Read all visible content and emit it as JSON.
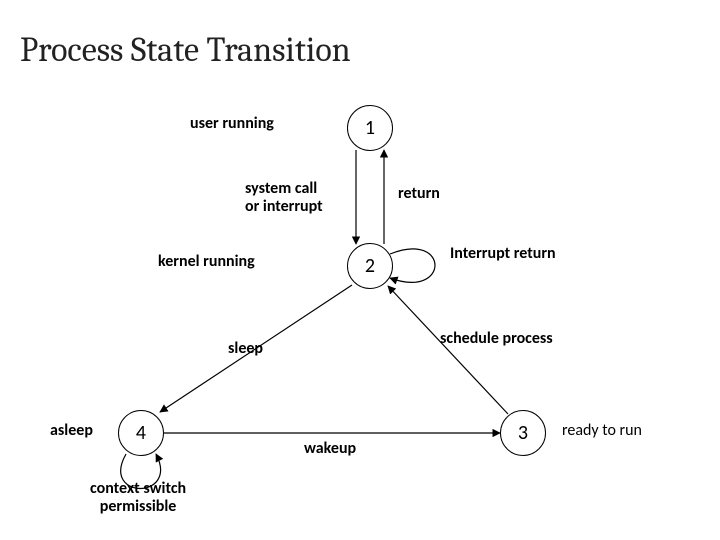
{
  "title": "Process State Transition",
  "nodes": {
    "n1": "1",
    "n2": "2",
    "n3": "3",
    "n4": "4"
  },
  "node_labels": {
    "user_running": "user running",
    "kernel_running": "kernel running",
    "asleep": "asleep",
    "ready_to_run": "ready to run"
  },
  "edge_labels": {
    "syscall": "system call\nor interrupt",
    "return": "return",
    "interrupt_return": "Interrupt return",
    "sleep": "sleep",
    "wakeup": "wakeup",
    "schedule": "schedule process",
    "context_switch": "context switch\npermissible"
  },
  "diagram": {
    "type": "state-transition",
    "states": [
      {
        "id": 1,
        "name": "user running"
      },
      {
        "id": 2,
        "name": "kernel running"
      },
      {
        "id": 3,
        "name": "ready to run"
      },
      {
        "id": 4,
        "name": "asleep"
      }
    ],
    "transitions": [
      {
        "from": 1,
        "to": 2,
        "label": "system call or interrupt"
      },
      {
        "from": 2,
        "to": 1,
        "label": "return"
      },
      {
        "from": 2,
        "to": 2,
        "label": "Interrupt return"
      },
      {
        "from": 2,
        "to": 4,
        "label": "sleep"
      },
      {
        "from": 4,
        "to": 3,
        "label": "wakeup"
      },
      {
        "from": 3,
        "to": 2,
        "label": "schedule process"
      },
      {
        "from": 4,
        "to": 4,
        "label": "context switch permissible"
      }
    ]
  }
}
